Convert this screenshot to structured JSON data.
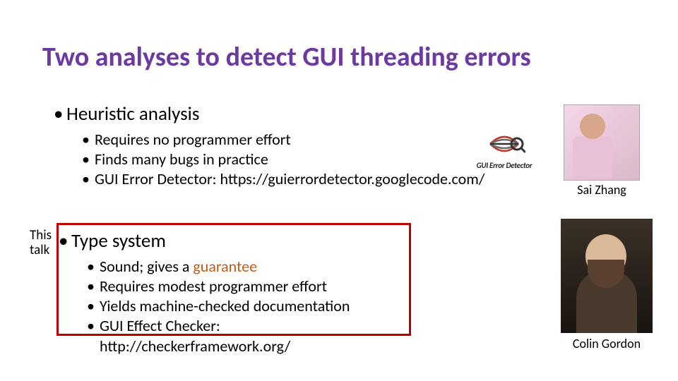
{
  "title": "Two analyses to detect GUI threading errors",
  "this_talk_label_line1": "This",
  "this_talk_label_line2": "talk",
  "heuristic": {
    "heading": "Heuristic analysis",
    "items": [
      "Requires no programmer effort",
      "Finds many bugs in practice",
      "GUI Error Detector:  https://guierrordetector.googlecode.com/"
    ]
  },
  "typesystem": {
    "heading": "Type system",
    "items": [
      {
        "pre": "Sound; gives a ",
        "em": "guarantee",
        "post": ""
      },
      {
        "pre": "Requires modest programmer effort",
        "em": "",
        "post": ""
      },
      {
        "pre": "Yields machine-checked documentation",
        "em": "",
        "post": ""
      },
      {
        "pre": "GUI Effect Checker:  http://checkerframework.org/",
        "em": "",
        "post": ""
      }
    ]
  },
  "logo_text": "GUI Error Detector",
  "captions": {
    "person1": "Sai Zhang",
    "person2": "Colin Gordon"
  }
}
